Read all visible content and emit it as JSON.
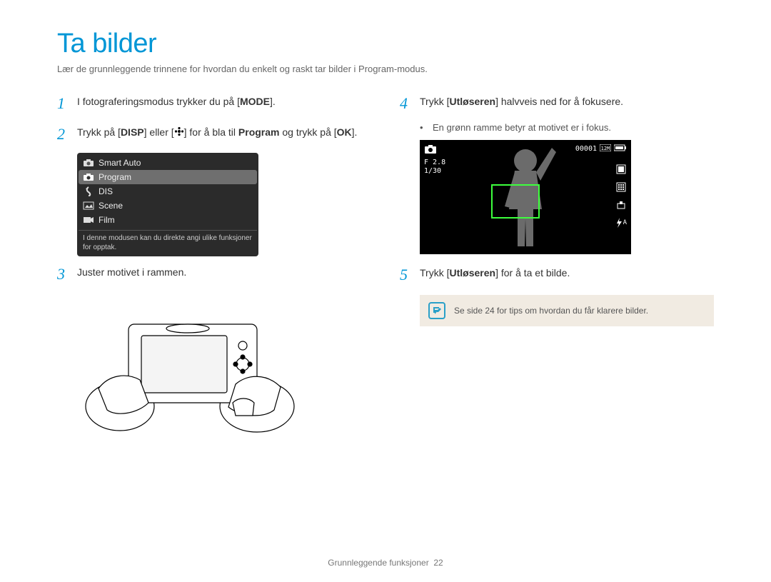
{
  "title": "Ta bilder",
  "subtitle": "Lær de grunnleggende trinnene for hvordan du enkelt og raskt tar bilder i Program-modus.",
  "steps": {
    "s1": {
      "num": "1",
      "pre": "I fotograferingsmodus trykker du på [",
      "key": "MODE",
      "post": "]."
    },
    "s2": {
      "num": "2",
      "pre": "Trykk på [",
      "key1": "DISP",
      "mid": "] eller [",
      "key2_icon": "flower-icon",
      "post1": "] for å bla til ",
      "bold": "Program",
      "post2": " og trykk på [",
      "key3": "OK",
      "post3": "]."
    },
    "s3": {
      "num": "3",
      "text": "Juster motivet i rammen."
    },
    "s4": {
      "num": "4",
      "pre": "Trykk [",
      "key": "Utløseren",
      "post": "] halvveis ned for å fokusere.",
      "bullet": "En grønn ramme betyr at motivet er i fokus."
    },
    "s5": {
      "num": "5",
      "pre": "Trykk [",
      "key": "Utløseren",
      "post": "] for å ta et bilde."
    }
  },
  "mode_menu": {
    "items": [
      {
        "label": "Smart Auto"
      },
      {
        "label": "Program",
        "selected": true
      },
      {
        "label": "DIS"
      },
      {
        "label": "Scene"
      },
      {
        "label": "Film"
      }
    ],
    "desc": "I denne modusen kan du direkte angi ulike funksjoner for opptak."
  },
  "lcd": {
    "counter": "00001",
    "fstop": "F 2.8",
    "shutter": "1/30",
    "flash_label": "A"
  },
  "tip": "Se side 24 for tips om hvordan du får klarere bilder.",
  "footer": {
    "section": "Grunnleggende funksjoner",
    "page": "22"
  }
}
